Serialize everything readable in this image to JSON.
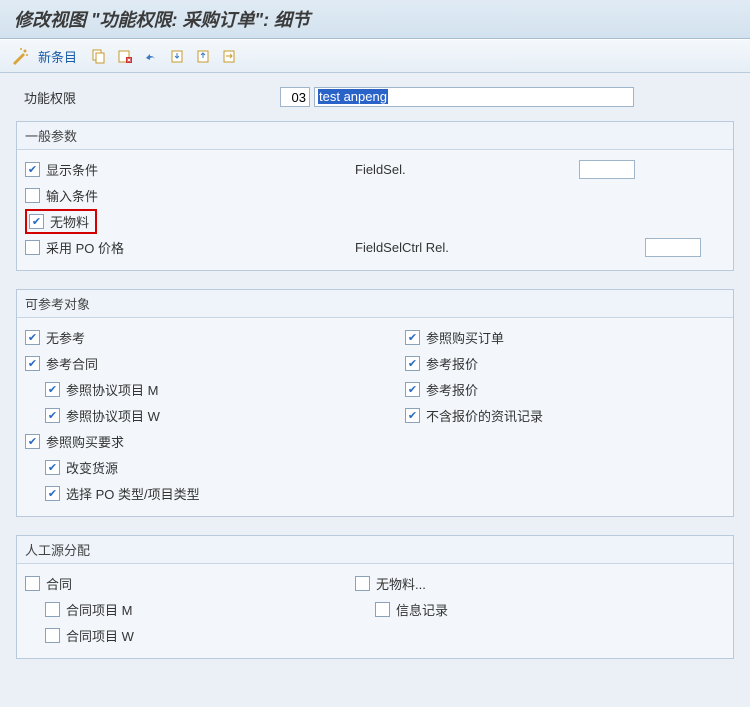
{
  "title": "修改视图 \"功能权限: 采购订单\": 细节",
  "toolbar": {
    "new_entry": "新条目"
  },
  "header": {
    "label": "功能权限",
    "code": "03",
    "desc": "test anpeng"
  },
  "panels": {
    "general": {
      "title": "一般参数",
      "display_cond": "显示条件",
      "input_cond": "输入条件",
      "no_material": "无物料",
      "adopt_po_price": "采用 PO 价格",
      "fieldsel": "FieldSel.",
      "fieldselctrl": "FieldSelCtrl Rel."
    },
    "ref": {
      "title": "可参考对象",
      "no_ref": "无参考",
      "ref_contract": "参考合同",
      "ref_agree_m": "参照协议项目 M",
      "ref_agree_w": "参照协议项目 W",
      "ref_preq": "参照购买要求",
      "change_source": "改变货源",
      "select_po_type": "选择 PO 类型/项目类型",
      "ref_po": "参照购买订单",
      "ref_quote1": "参考报价",
      "ref_quote2": "参考报价",
      "no_quote_info": "不含报价的资讯记录"
    },
    "manual": {
      "title": "人工源分配",
      "contract": "合同",
      "contract_m": "合同项目 M",
      "contract_w": "合同项目 W",
      "no_material": "无物料...",
      "info_record": "信息记录"
    }
  }
}
